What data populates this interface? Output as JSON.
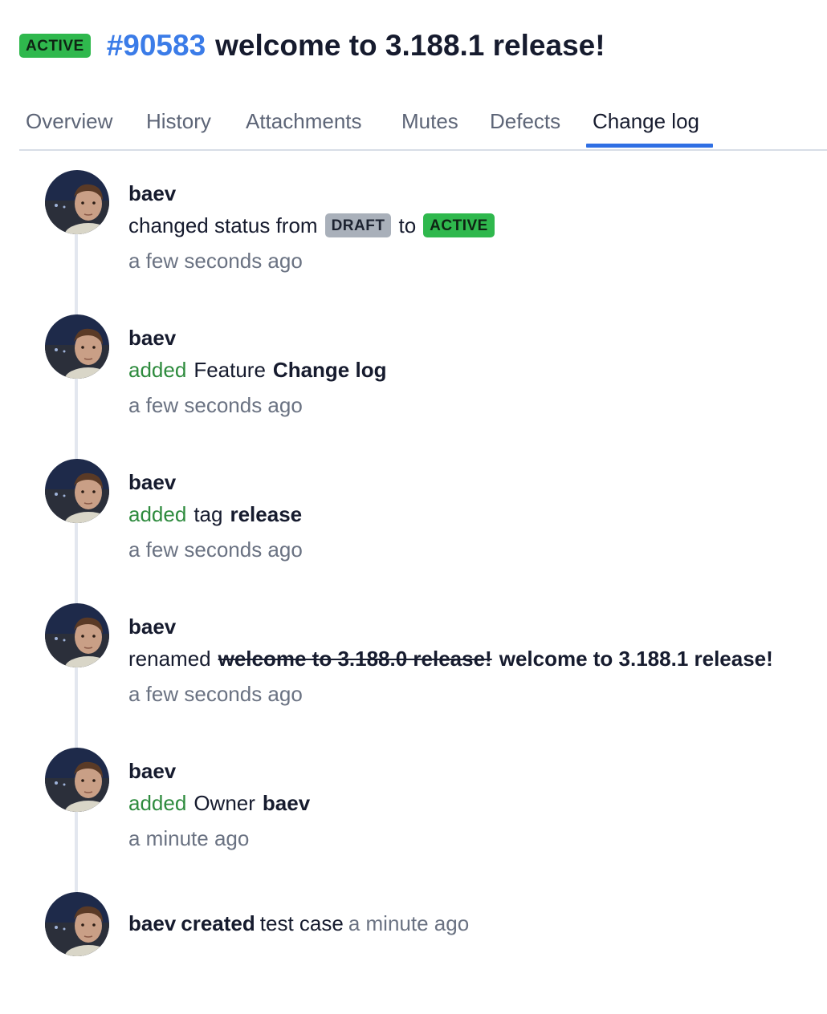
{
  "header": {
    "status_badge": "ACTIVE",
    "case_id": "#90583",
    "title": "welcome to 3.188.1 release!",
    "status_color": "#2fb84d",
    "id_color": "#3b7ce8"
  },
  "tabs": [
    {
      "label": "Overview"
    },
    {
      "label": "History"
    },
    {
      "label": "Attachments"
    },
    {
      "label": "Mutes"
    },
    {
      "label": "Defects"
    },
    {
      "label": "Change log",
      "active": true
    }
  ],
  "entries": [
    {
      "user": "baev",
      "text": "changed status from",
      "from_status": "DRAFT",
      "connector": "to",
      "to_status": "ACTIVE",
      "time": "a few seconds ago"
    },
    {
      "user": "baev",
      "verb": "added",
      "object_type": "Feature",
      "object_value": "Change log",
      "time": "a few seconds ago"
    },
    {
      "user": "baev",
      "verb": "added",
      "object_type": "tag",
      "object_value": "release",
      "time": "a few seconds ago"
    },
    {
      "user": "baev",
      "verb": "renamed",
      "old_name": "welcome to 3.188.0 release!",
      "new_name": "welcome to 3.188.1 release!",
      "time": "a few seconds ago"
    },
    {
      "user": "baev",
      "verb": "added",
      "object_type": "Owner",
      "object_value": "baev",
      "time": "a minute ago"
    },
    {
      "user": "baev",
      "verb": "created",
      "object_type": "test case",
      "time": "a minute ago"
    }
  ],
  "avatar_icon": "user-photo"
}
